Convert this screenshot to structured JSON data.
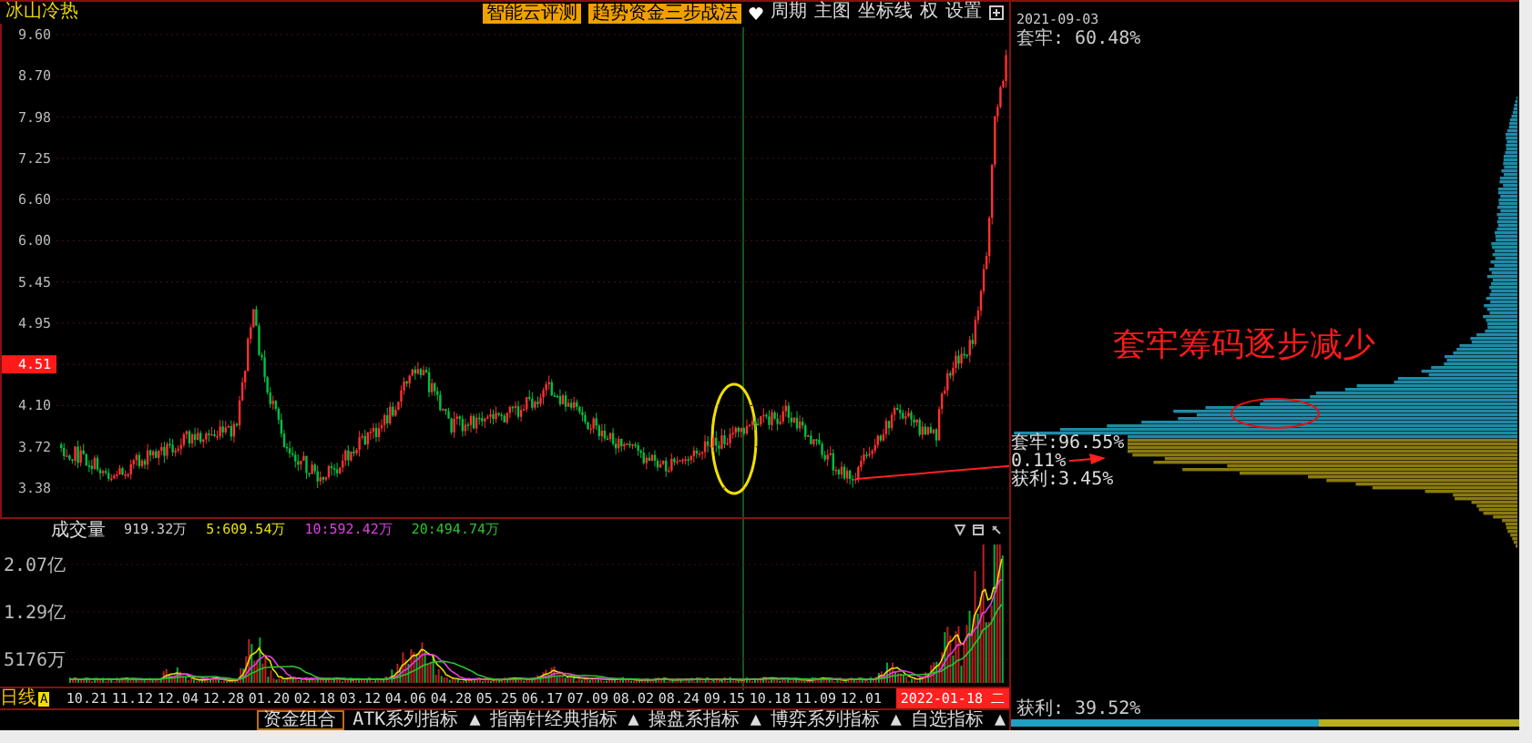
{
  "header": {
    "title": "冰山冷热",
    "buttons": [
      "智能云评测",
      "趋势资金三步战法"
    ],
    "menu": [
      "周期",
      "主图",
      "坐标线",
      "权",
      "设置"
    ]
  },
  "price_axis": [
    {
      "label": "9.60",
      "highlighted": false
    },
    {
      "label": "8.70",
      "highlighted": false
    },
    {
      "label": "7.98",
      "highlighted": false
    },
    {
      "label": "7.25",
      "highlighted": false
    },
    {
      "label": "6.60",
      "highlighted": false
    },
    {
      "label": "6.00",
      "highlighted": false
    },
    {
      "label": "5.45",
      "highlighted": false
    },
    {
      "label": "4.95",
      "highlighted": false
    },
    {
      "label": "4.51",
      "highlighted": true
    },
    {
      "label": "4.10",
      "highlighted": false
    },
    {
      "label": "3.72",
      "highlighted": false
    },
    {
      "label": "3.38",
      "highlighted": false
    }
  ],
  "volume": {
    "title": "成交量",
    "readings": [
      {
        "text": "919.32万",
        "color": "#d0d0d0"
      },
      {
        "text": "5:609.54万",
        "color": "#e8e000"
      },
      {
        "text": "10:592.42万",
        "color": "#e040e0"
      },
      {
        "text": "20:494.74万",
        "color": "#30c030"
      }
    ],
    "axis": [
      "2.07亿",
      "1.29亿",
      "5176万"
    ]
  },
  "date_axis": {
    "period": "日线",
    "period_badge": "A",
    "dates": [
      "10.21",
      "11.12",
      "12.04",
      "12.28",
      "01.20",
      "02.18",
      "03.12",
      "04.06",
      "04.28",
      "05.25",
      "06.17",
      "07.09",
      "08.02",
      "08.24",
      "09.15",
      "10.18",
      "11.09",
      "12.01"
    ],
    "cursor_date": "2022-01-18 二"
  },
  "toolbar": [
    {
      "label": "资金组合",
      "kind": "tab"
    },
    {
      "label": "ATK系列指标",
      "kind": "menu",
      "arrow": "▲"
    },
    {
      "label": "指南针经典指标",
      "kind": "menu",
      "arrow": "▲"
    },
    {
      "label": "操盘系指标",
      "kind": "menu",
      "arrow": "▲"
    },
    {
      "label": "博弈系列指标",
      "kind": "menu",
      "arrow": "▲"
    },
    {
      "label": "自选指标",
      "kind": "menu",
      "arrow": "▲"
    }
  ],
  "chip_panel": {
    "date": "2021-09-03",
    "trapped_top": "套牢: 60.48%",
    "annotation": "套牢筹码逐步减少",
    "readings": [
      "套牢:96.55%",
      "0.11%",
      "获利:3.45%"
    ],
    "profit": "获利: 39.52%",
    "level": 0.6048
  }
}
